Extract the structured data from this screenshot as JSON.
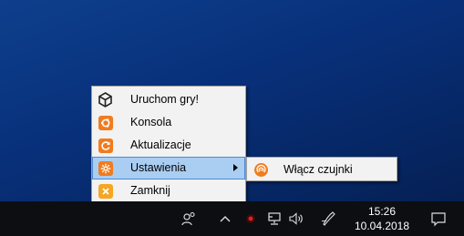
{
  "context_menu": {
    "items": [
      {
        "label": "Uruchom gry!",
        "icon": "unity-logo-icon"
      },
      {
        "label": "Konsola",
        "icon": "ubuntu-console-icon"
      },
      {
        "label": "Aktualizacje",
        "icon": "update-icon"
      },
      {
        "label": "Ustawienia",
        "icon": "settings-icon",
        "selected": true,
        "has_submenu": true
      },
      {
        "label": "Zamknij",
        "icon": "close-icon"
      }
    ]
  },
  "submenu": {
    "items": [
      {
        "label": "Włącz czujnki",
        "icon": "sensor-icon"
      }
    ]
  },
  "taskbar": {
    "clock_time": "15:26",
    "clock_date": "10.04.2018"
  },
  "colors": {
    "accent_orange": "#f07c1f",
    "selection": "#aacdf2",
    "taskbar": "#0c0e12",
    "desktop": "#0a3580"
  }
}
